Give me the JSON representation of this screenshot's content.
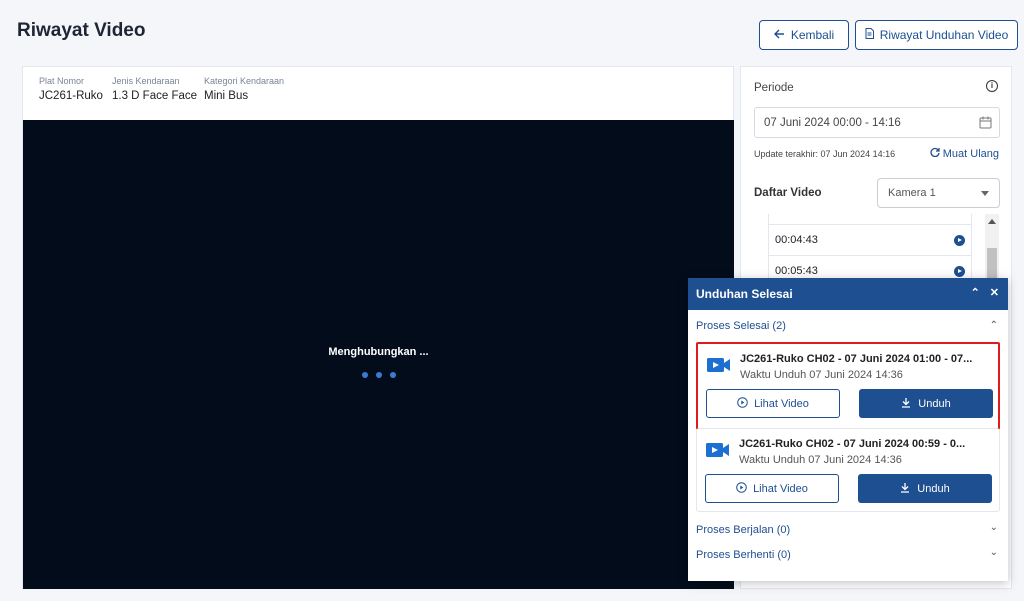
{
  "page": {
    "title": "Riwayat Video"
  },
  "header": {
    "back_label": "Kembali",
    "history_label": "Riwayat Unduhan Video"
  },
  "vehicle": {
    "plate_label": "Plat Nomor",
    "plate_value": "JC261-Ruko",
    "type_label": "Jenis Kendaraan",
    "type_value": "1.3 D Face Face",
    "category_label": "Kategori Kendaraan",
    "category_value": "Mini Bus"
  },
  "player": {
    "status": "Menghubungkan ..."
  },
  "sidebar": {
    "periode_label": "Periode",
    "date_range": "07 Juni 2024 00:00 - 14:16",
    "update_text": "Update terakhir: 07 Jun 2024 14:16",
    "reload_label": "Muat Ulang",
    "daftar_label": "Daftar Video",
    "camera_selected": "Kamera 1",
    "videos": [
      {
        "time": "00:04:43"
      },
      {
        "time": "00:05:43"
      }
    ]
  },
  "downloads": {
    "title": "Unduhan Selesai",
    "done_section": "Proses Selesai (2)",
    "items": [
      {
        "title": "JC261-Ruko CH02 - 07 Juni 2024 01:00 - 07...",
        "time": "Waktu Unduh 07 Juni 2024 14:36",
        "view_label": "Lihat Video",
        "download_label": "Unduh"
      },
      {
        "title": "JC261-Ruko CH02 - 07 Juni 2024 00:59 - 0...",
        "time": "Waktu Unduh 07 Juni 2024 14:36",
        "view_label": "Lihat Video",
        "download_label": "Unduh"
      }
    ],
    "running_section": "Proses Berjalan (0)",
    "stopped_section": "Proses Berhenti (0)"
  },
  "colors": {
    "primary": "#1d4f91",
    "player_bg": "#020c1b",
    "highlight": "#e01b1b"
  }
}
